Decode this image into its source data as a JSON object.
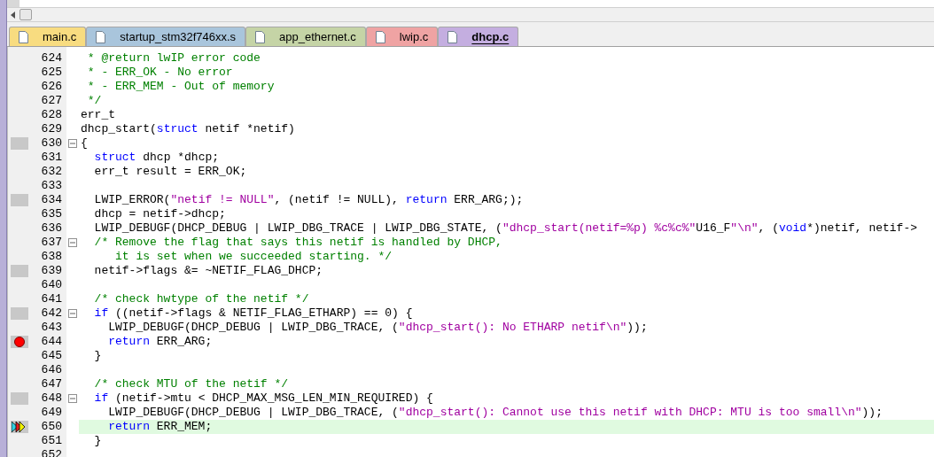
{
  "tabs": [
    {
      "label": "main.c",
      "color": "#f8dc80",
      "selected": false
    },
    {
      "label": "startup_stm32f746xx.s",
      "color": "#a9c5dc",
      "selected": false
    },
    {
      "label": "app_ethernet.c",
      "color": "#c5d4a6",
      "selected": false
    },
    {
      "label": "lwip.c",
      "color": "#efa3a3",
      "selected": false
    },
    {
      "label": "dhcp.c",
      "color": "#c4aee0",
      "selected": true
    }
  ],
  "lines": [
    {
      "number": "624",
      "has_code": false,
      "breakpoint": false,
      "current": false,
      "foldable": false,
      "tokens": [
        {
          "kind": "comment",
          "text": " * @return lwIP error code"
        }
      ]
    },
    {
      "number": "625",
      "has_code": false,
      "breakpoint": false,
      "current": false,
      "foldable": false,
      "tokens": [
        {
          "kind": "comment",
          "text": " * - ERR_OK - No error"
        }
      ]
    },
    {
      "number": "626",
      "has_code": false,
      "breakpoint": false,
      "current": false,
      "foldable": false,
      "tokens": [
        {
          "kind": "comment",
          "text": " * - ERR_MEM - Out of memory"
        }
      ]
    },
    {
      "number": "627",
      "has_code": false,
      "breakpoint": false,
      "current": false,
      "foldable": false,
      "tokens": [
        {
          "kind": "comment",
          "text": " */"
        }
      ]
    },
    {
      "number": "628",
      "has_code": false,
      "breakpoint": false,
      "current": false,
      "foldable": false,
      "tokens": [
        {
          "kind": "plain",
          "text": "err_t"
        }
      ]
    },
    {
      "number": "629",
      "has_code": false,
      "breakpoint": false,
      "current": false,
      "foldable": false,
      "tokens": [
        {
          "kind": "plain",
          "text": "dhcp_start("
        },
        {
          "kind": "keyword",
          "text": "struct"
        },
        {
          "kind": "plain",
          "text": " netif *netif)"
        }
      ]
    },
    {
      "number": "630",
      "has_code": true,
      "breakpoint": false,
      "current": false,
      "foldable": true,
      "tokens": [
        {
          "kind": "plain",
          "text": "{"
        }
      ]
    },
    {
      "number": "631",
      "has_code": false,
      "breakpoint": false,
      "current": false,
      "foldable": false,
      "tokens": [
        {
          "kind": "keyword",
          "text": "  struct"
        },
        {
          "kind": "plain",
          "text": " dhcp *dhcp;"
        }
      ]
    },
    {
      "number": "632",
      "has_code": false,
      "breakpoint": false,
      "current": false,
      "foldable": false,
      "tokens": [
        {
          "kind": "plain",
          "text": "  err_t result = ERR_OK;"
        }
      ]
    },
    {
      "number": "633",
      "has_code": false,
      "breakpoint": false,
      "current": false,
      "foldable": false
    },
    {
      "number": "634",
      "has_code": true,
      "breakpoint": false,
      "current": false,
      "foldable": false,
      "tokens": [
        {
          "kind": "plain",
          "text": "  LWIP_ERROR("
        },
        {
          "kind": "string",
          "text": "\"netif != NULL\""
        },
        {
          "kind": "plain",
          "text": ", (netif != NULL), "
        },
        {
          "kind": "keyword",
          "text": "return"
        },
        {
          "kind": "plain",
          "text": " ERR_ARG;);"
        }
      ]
    },
    {
      "number": "635",
      "has_code": false,
      "breakpoint": false,
      "current": false,
      "foldable": false,
      "tokens": [
        {
          "kind": "plain",
          "text": "  dhcp = netif->dhcp;"
        }
      ]
    },
    {
      "number": "636",
      "has_code": false,
      "breakpoint": false,
      "current": false,
      "foldable": false,
      "tokens": [
        {
          "kind": "plain",
          "text": "  LWIP_DEBUGF(DHCP_DEBUG | LWIP_DBG_TRACE | LWIP_DBG_STATE, ("
        },
        {
          "kind": "string",
          "text": "\"dhcp_start(netif=%p) %c%c%\""
        },
        {
          "kind": "plain",
          "text": "U16_F"
        },
        {
          "kind": "string",
          "text": "\"\\n\""
        },
        {
          "kind": "plain",
          "text": ", ("
        },
        {
          "kind": "keyword",
          "text": "void"
        },
        {
          "kind": "plain",
          "text": "*)netif, netif->"
        }
      ]
    },
    {
      "number": "637",
      "has_code": false,
      "breakpoint": false,
      "current": false,
      "foldable": true,
      "tokens": [
        {
          "kind": "comment",
          "text": "  /* Remove the flag that says this netif is handled by DHCP,"
        }
      ]
    },
    {
      "number": "638",
      "has_code": false,
      "breakpoint": false,
      "current": false,
      "foldable": false,
      "tokens": [
        {
          "kind": "comment",
          "text": "     it is set when we succeeded starting. */"
        }
      ]
    },
    {
      "number": "639",
      "has_code": true,
      "breakpoint": false,
      "current": false,
      "foldable": false,
      "tokens": [
        {
          "kind": "plain",
          "text": "  netif->flags &= ~NETIF_FLAG_DHCP;"
        }
      ]
    },
    {
      "number": "640",
      "has_code": false,
      "breakpoint": false,
      "current": false,
      "foldable": false
    },
    {
      "number": "641",
      "has_code": false,
      "breakpoint": false,
      "current": false,
      "foldable": false,
      "tokens": [
        {
          "kind": "comment",
          "text": "  /* check hwtype of the netif */"
        }
      ]
    },
    {
      "number": "642",
      "has_code": true,
      "breakpoint": false,
      "current": false,
      "foldable": true,
      "tokens": [
        {
          "kind": "keyword",
          "text": "  if"
        },
        {
          "kind": "plain",
          "text": " ((netif->flags & NETIF_FLAG_ETHARP) == 0) {"
        }
      ]
    },
    {
      "number": "643",
      "has_code": false,
      "breakpoint": false,
      "current": false,
      "foldable": false,
      "tokens": [
        {
          "kind": "plain",
          "text": "    LWIP_DEBUGF(DHCP_DEBUG | LWIP_DBG_TRACE, ("
        },
        {
          "kind": "string",
          "text": "\"dhcp_start(): No ETHARP netif\\n\""
        },
        {
          "kind": "plain",
          "text": "));"
        }
      ]
    },
    {
      "number": "644",
      "has_code": true,
      "breakpoint": true,
      "current": false,
      "foldable": false,
      "tokens": [
        {
          "kind": "keyword",
          "text": "    return"
        },
        {
          "kind": "plain",
          "text": " ERR_ARG;"
        }
      ]
    },
    {
      "number": "645",
      "has_code": false,
      "breakpoint": false,
      "current": false,
      "foldable": false,
      "tokens": [
        {
          "kind": "plain",
          "text": "  }"
        }
      ]
    },
    {
      "number": "646",
      "has_code": false,
      "breakpoint": false,
      "current": false,
      "foldable": false
    },
    {
      "number": "647",
      "has_code": false,
      "breakpoint": false,
      "current": false,
      "foldable": false,
      "tokens": [
        {
          "kind": "comment",
          "text": "  /* check MTU of the netif */"
        }
      ]
    },
    {
      "number": "648",
      "has_code": true,
      "breakpoint": false,
      "current": false,
      "foldable": true,
      "tokens": [
        {
          "kind": "keyword",
          "text": "  if"
        },
        {
          "kind": "plain",
          "text": " (netif->mtu < DHCP_MAX_MSG_LEN_MIN_REQUIRED) {"
        }
      ]
    },
    {
      "number": "649",
      "has_code": false,
      "breakpoint": false,
      "current": false,
      "foldable": false,
      "tokens": [
        {
          "kind": "plain",
          "text": "    LWIP_DEBUGF(DHCP_DEBUG | LWIP_DBG_TRACE, ("
        },
        {
          "kind": "string",
          "text": "\"dhcp_start(): Cannot use this netif with DHCP: MTU is too small\\n\""
        },
        {
          "kind": "plain",
          "text": "));"
        }
      ]
    },
    {
      "number": "650",
      "has_code": true,
      "breakpoint": false,
      "current": true,
      "foldable": false,
      "tokens": [
        {
          "kind": "keyword",
          "text": "    return"
        },
        {
          "kind": "plain",
          "text": " ERR_MEM;"
        }
      ]
    },
    {
      "number": "651",
      "has_code": false,
      "breakpoint": false,
      "current": false,
      "foldable": false,
      "tokens": [
        {
          "kind": "plain",
          "text": "  }"
        }
      ]
    },
    {
      "number": "652",
      "has_code": false,
      "breakpoint": false,
      "current": false,
      "foldable": false
    }
  ]
}
